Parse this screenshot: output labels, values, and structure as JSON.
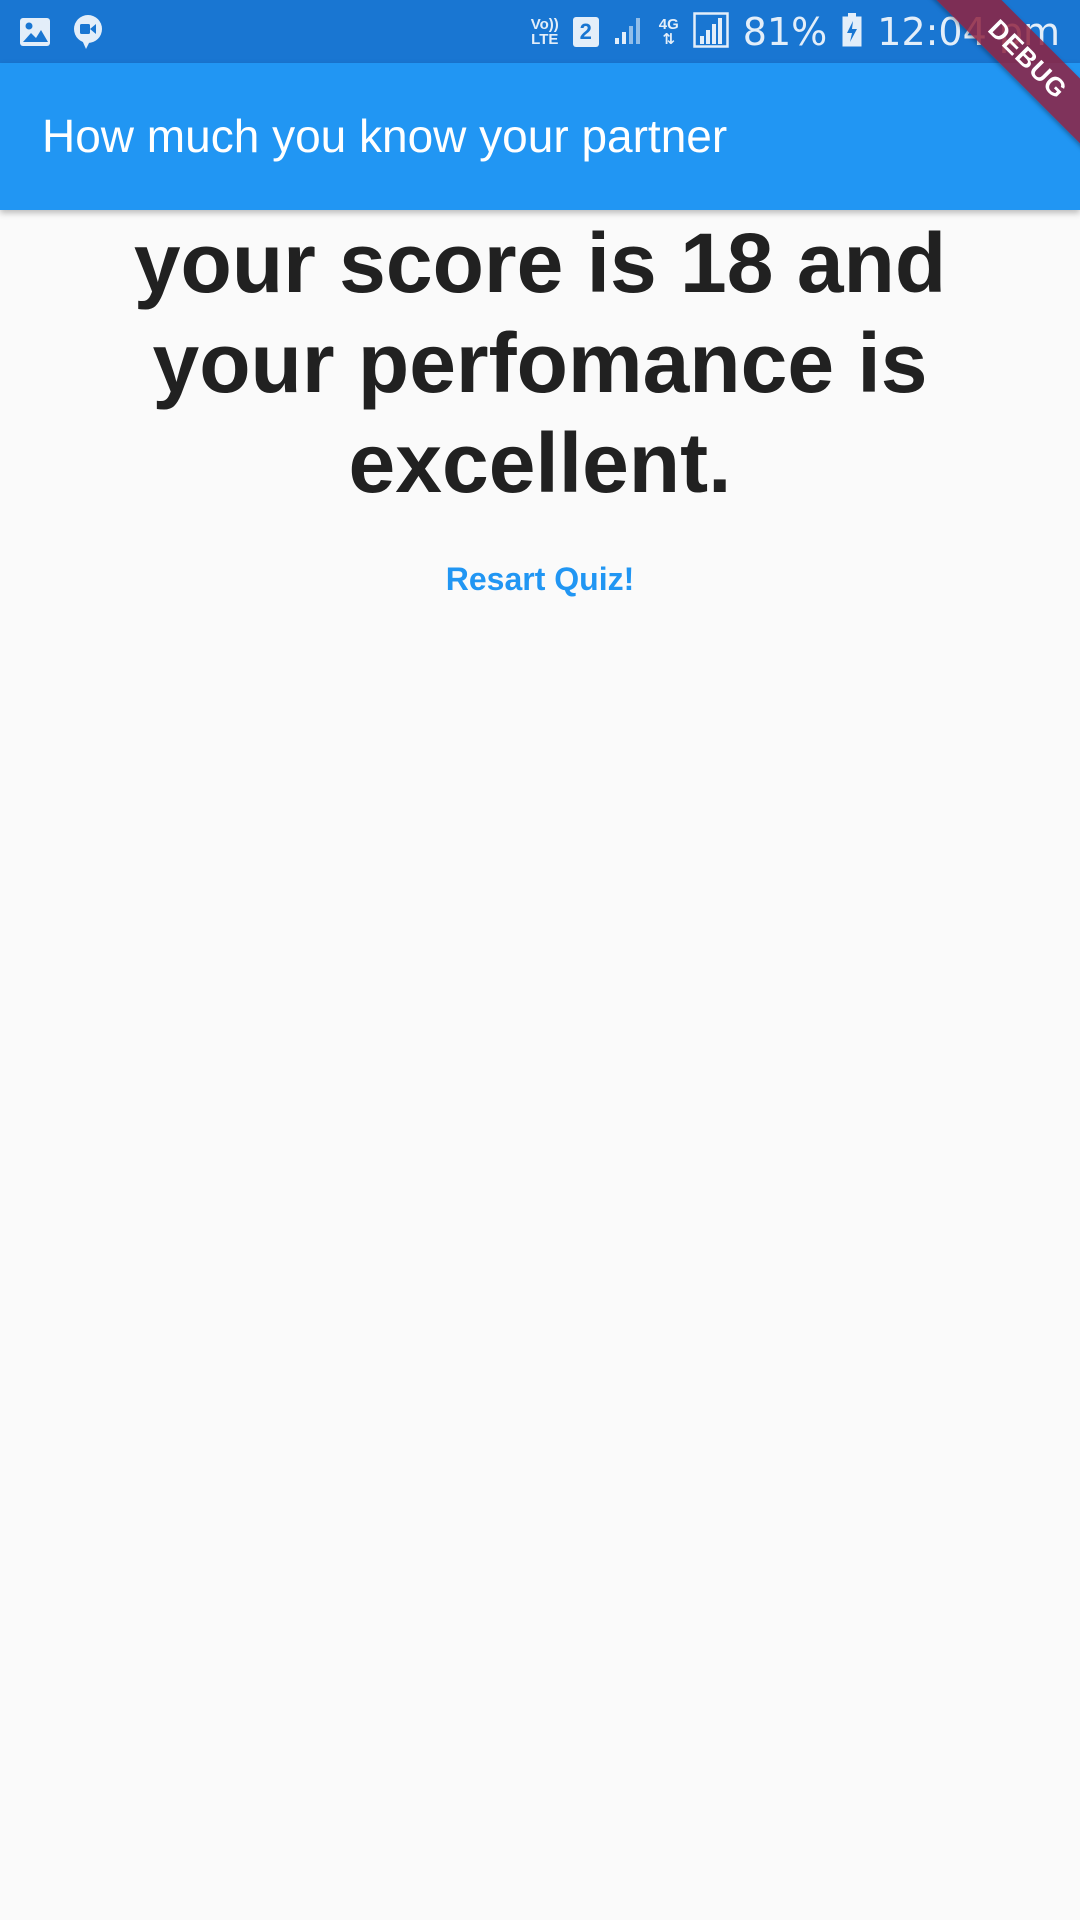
{
  "status_bar": {
    "left_icons": [
      "gallery-icon",
      "video-chat-icon"
    ],
    "volte": "Vo))",
    "lte": "LTE",
    "sim": "2",
    "network": "4G",
    "battery": "81%",
    "time": "12:04 pm"
  },
  "app_bar": {
    "title": "How much you know your partner"
  },
  "result": {
    "text": "your score is 18 and your perfomance is excellent.",
    "restart_label": "Resart Quiz!"
  },
  "debug_banner": {
    "label": "DEBUG"
  },
  "colors": {
    "status_bar": "#1976d2",
    "app_bar": "#2196f3",
    "background": "#fafafa",
    "text": "#212121",
    "accent": "#2196f3",
    "debug": "#8f2240"
  }
}
